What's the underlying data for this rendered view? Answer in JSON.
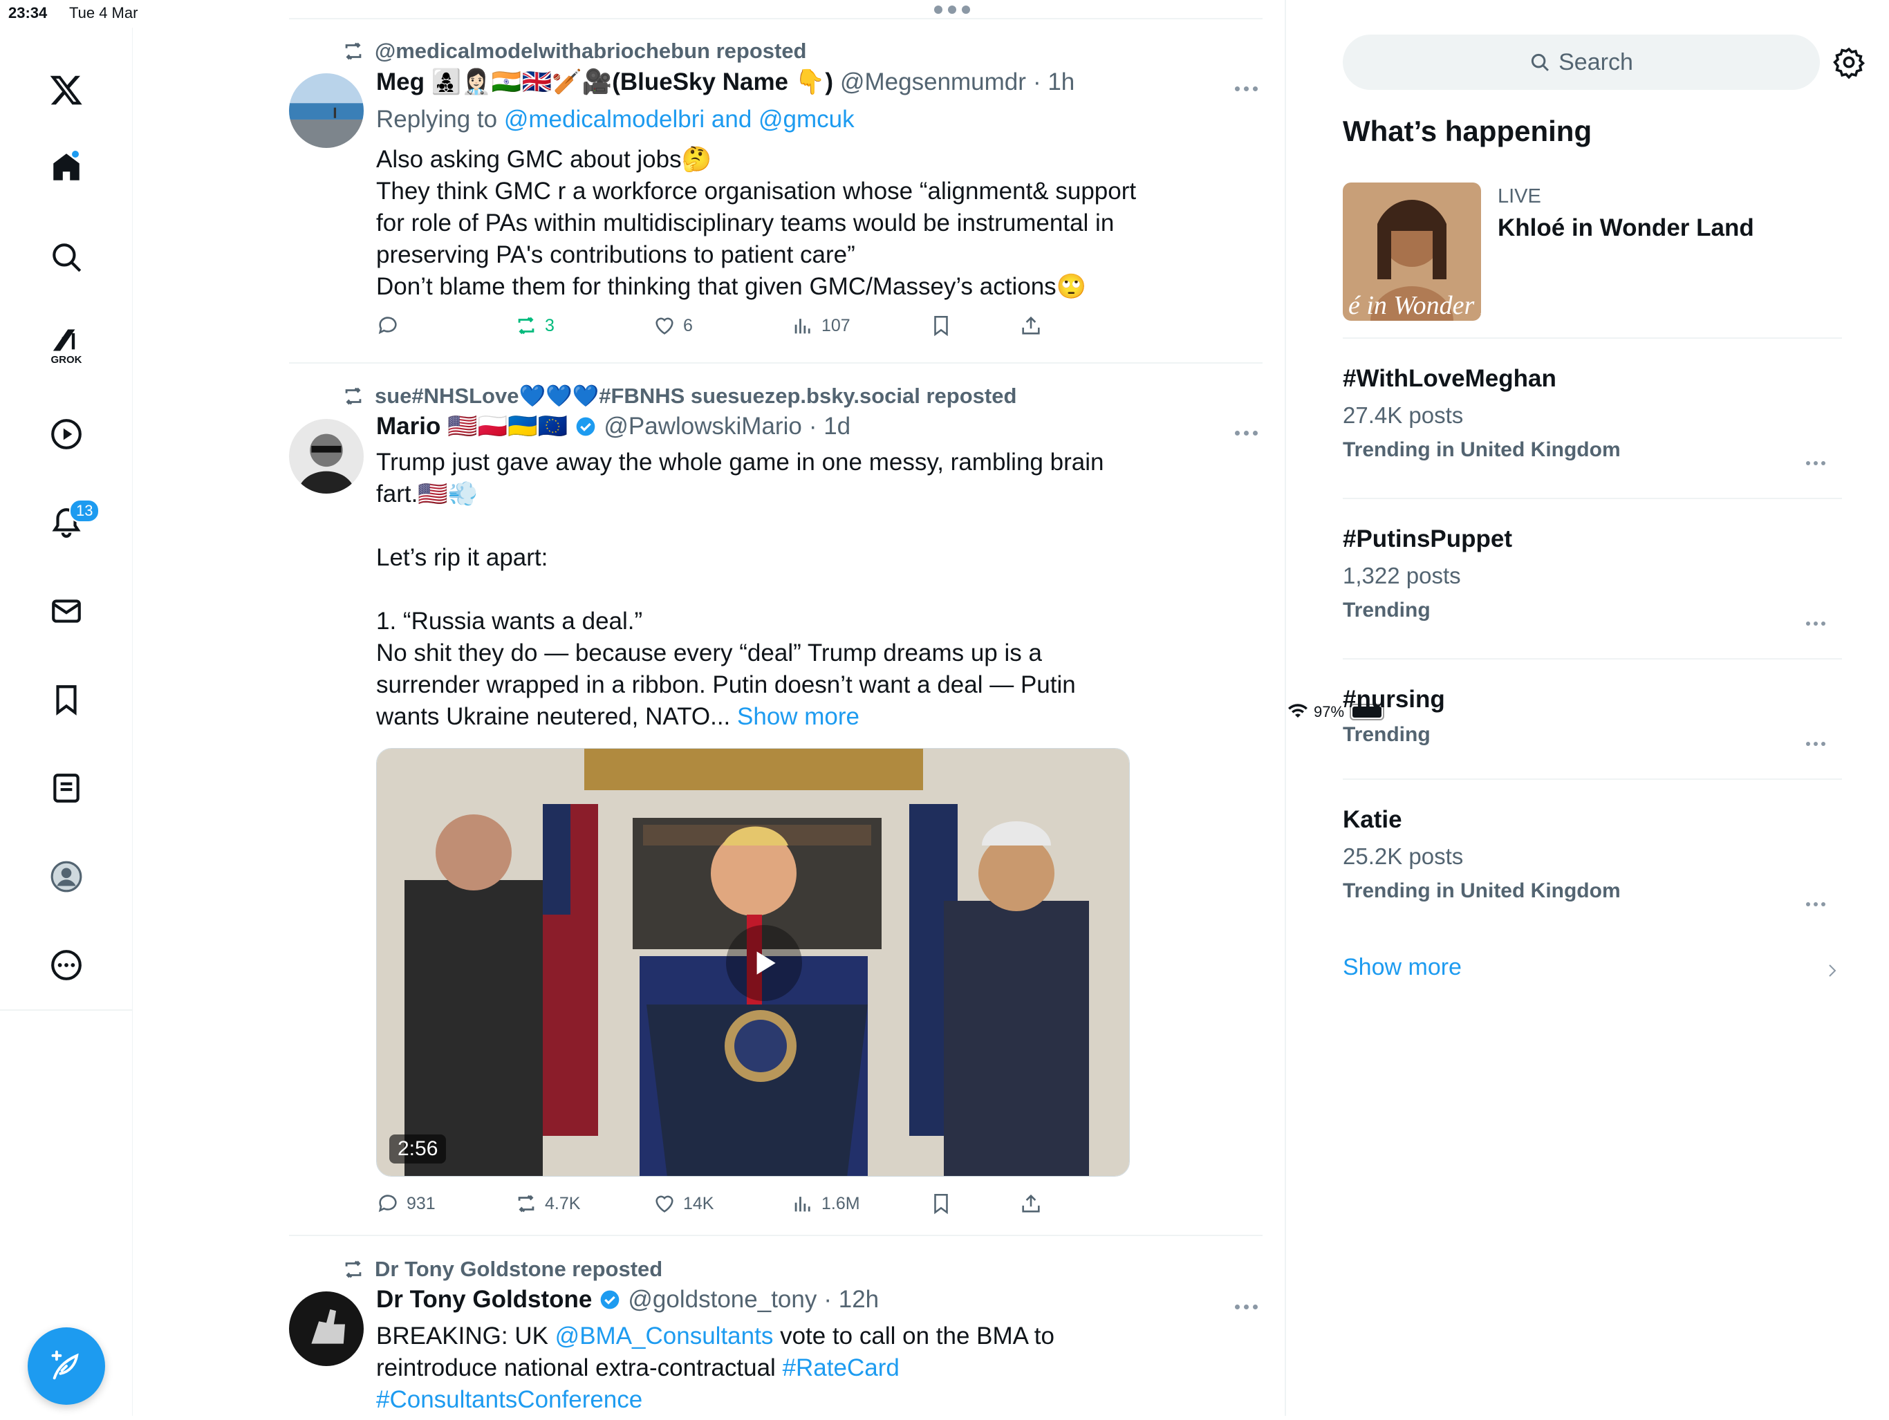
{
  "status": {
    "time": "23:34",
    "date": "Tue 4 Mar",
    "battery": "97%",
    "battery_level": 0.97
  },
  "nav": {
    "notifications_badge": "13",
    "grok_label": "GROK"
  },
  "posts": [
    {
      "repost_label": "@medicalmodelwithabriochebun reposted",
      "name": "Meg 👩‍👧‍👦👩🏻‍⚕️🇮🇳🇬🇧🏏🎥(BlueSky Name 👇)",
      "handle": "@Megsenmumdr",
      "time": "· 1h",
      "replying_prefix": "Replying to ",
      "replying_to": "@medicalmodelbri and @gmcuk",
      "text": "Also asking GMC about jobs🤔\nThey think GMC r a workforce organisation whose “alignment& support for role of PAs within multidisciplinary teams would be instrumental in preserving PA's contributions to patient care”\nDon’t blame them for thinking that given GMC/Massey’s actions🙄",
      "replies": "",
      "reposts": "3",
      "likes": "6",
      "views": "107"
    },
    {
      "repost_label": "sue#NHSLove💙💙💙#FBNHS suesuezep.bsky.social reposted",
      "name": "Mario 🇺🇸🇵🇱🇺🇦🇪🇺",
      "handle": "@PawlowskiMario",
      "time": "· 1d",
      "text": "Trump just gave away the whole game in one messy, rambling brain fart.🇺🇸💨\n\nLet’s rip it apart:\n\n1. “Russia wants a deal.”\nNo shit they do — because every “deal” Trump dreams up is a surrender wrapped in a ribbon. Putin doesn’t want a deal — Putin wants Ukraine neutered, NATO...",
      "show_more": " Show more",
      "video_duration": "2:56",
      "replies": "931",
      "reposts": "4.7K",
      "likes": "14K",
      "views": "1.6M"
    },
    {
      "repost_label": "Dr Tony Goldstone reposted",
      "name": "Dr Tony Goldstone",
      "handle": "@goldstone_tony",
      "time": "· 12h",
      "text_prefix": "BREAKING: UK ",
      "mention": "@BMA_Consultants",
      "text_mid": " vote to call on the BMA to reintroduce national extra-contractual ",
      "tag1": "#RateCard",
      "tag2": "#ConsultantsConference"
    }
  ],
  "sidebar": {
    "search_placeholder": "Search",
    "whats_happening": "What’s happening",
    "live_label": "LIVE",
    "live_title": "Khloé in Wonder Land",
    "live_image_text": "é in Wonder L",
    "trends": [
      {
        "tag": "#WithLoveMeghan",
        "count": "27.4K posts",
        "context": "Trending in United Kingdom"
      },
      {
        "tag": "#PutinsPuppet",
        "count": "1,322 posts",
        "context": "Trending"
      },
      {
        "tag": "#nursing",
        "count": "",
        "context": "Trending"
      },
      {
        "tag": "Katie",
        "count": "25.2K posts",
        "context": "Trending in United Kingdom"
      }
    ],
    "show_more": "Show more"
  },
  "colors": {
    "accent": "#1d9bf0",
    "repost_green": "#00ba7c",
    "muted": "#536471"
  }
}
